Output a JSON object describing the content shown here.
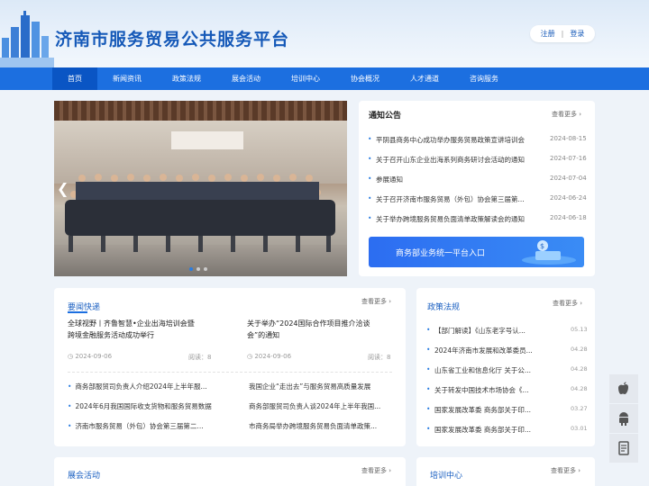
{
  "header": {
    "title": "济南市服务贸易公共服务平台",
    "register": "注册",
    "divider": "|",
    "login": "登录"
  },
  "nav": [
    "首页",
    "新闻资讯",
    "政策法规",
    "展会活动",
    "培训中心",
    "协会概况",
    "人才通道",
    "咨询服务"
  ],
  "colors": {
    "primary": "#1c6fe0",
    "active_nav": "#0a55c4",
    "title": "#1559b8",
    "bullet": "#2a7de1"
  },
  "banner": {
    "slides": 3,
    "active_slide": 1
  },
  "notice": {
    "title": "通知公告",
    "more": "查看更多",
    "items": [
      {
        "text": "平阴县商务中心成功举办服务贸易政策宣讲培训会",
        "date": "2024-08-15"
      },
      {
        "text": "关于召开山东企业出海系列商务研讨会活动的通知",
        "date": "2024-07-16"
      },
      {
        "text": "参展通知",
        "date": "2024-07-04"
      },
      {
        "text": "关于召开济南市服务贸易（外包）协会第三届第...",
        "date": "2024-06-24"
      },
      {
        "text": "关于举办跨境服务贸易负面清单政策解读会的通知",
        "date": "2024-06-18"
      }
    ],
    "portal": "商务部业务统一平台入口"
  },
  "news": {
    "title": "要闻快递",
    "more": "查看更多",
    "featured": [
      {
        "line1": "全球视野丨齐鲁智慧•企业出海培训会暨",
        "line2": "跨境金融服务活动成功举行",
        "date": "2024-09-06",
        "reads": "阅读：8"
      },
      {
        "line1": "关于举办“2024国际合作项目推介洽谈",
        "line2": "会”的通知",
        "date": "2024-09-06",
        "reads": "阅读：8"
      }
    ],
    "left_items": [
      "商务部服贸司负责人介绍2024年上半年服...",
      "2024年6月我国国际收支货物和服务贸易数据",
      "济南市服务贸易（外包）协会第三届第二..."
    ],
    "right_items": [
      "我国企业“走出去”与服务贸易高质量发展",
      "商务部服贸司负责人谈2024年上半年我国...",
      "市商务局举办跨境服务贸易负面清单政策..."
    ]
  },
  "policy": {
    "title": "政策法规",
    "more": "查看更多",
    "items": [
      {
        "text": "【部门解读】《山东老字号认...",
        "date": "05.13"
      },
      {
        "text": "2024年济南市发展和改革委员...",
        "date": "04.28"
      },
      {
        "text": "山东省工业和信息化厅 关于公...",
        "date": "04.28"
      },
      {
        "text": "关于转发中国技术市场协会《...",
        "date": "04.28"
      },
      {
        "text": "国家发展改革委 商务部关于印...",
        "date": "03.27"
      },
      {
        "text": "国家发展改革委 商务部关于印...",
        "date": "03.01"
      }
    ]
  },
  "exhibit": {
    "title": "展会活动",
    "more": "查看更多"
  },
  "training": {
    "title": "培训中心",
    "more": "查看更多"
  },
  "side_icons": [
    "apple-icon",
    "android-icon",
    "document-icon"
  ]
}
